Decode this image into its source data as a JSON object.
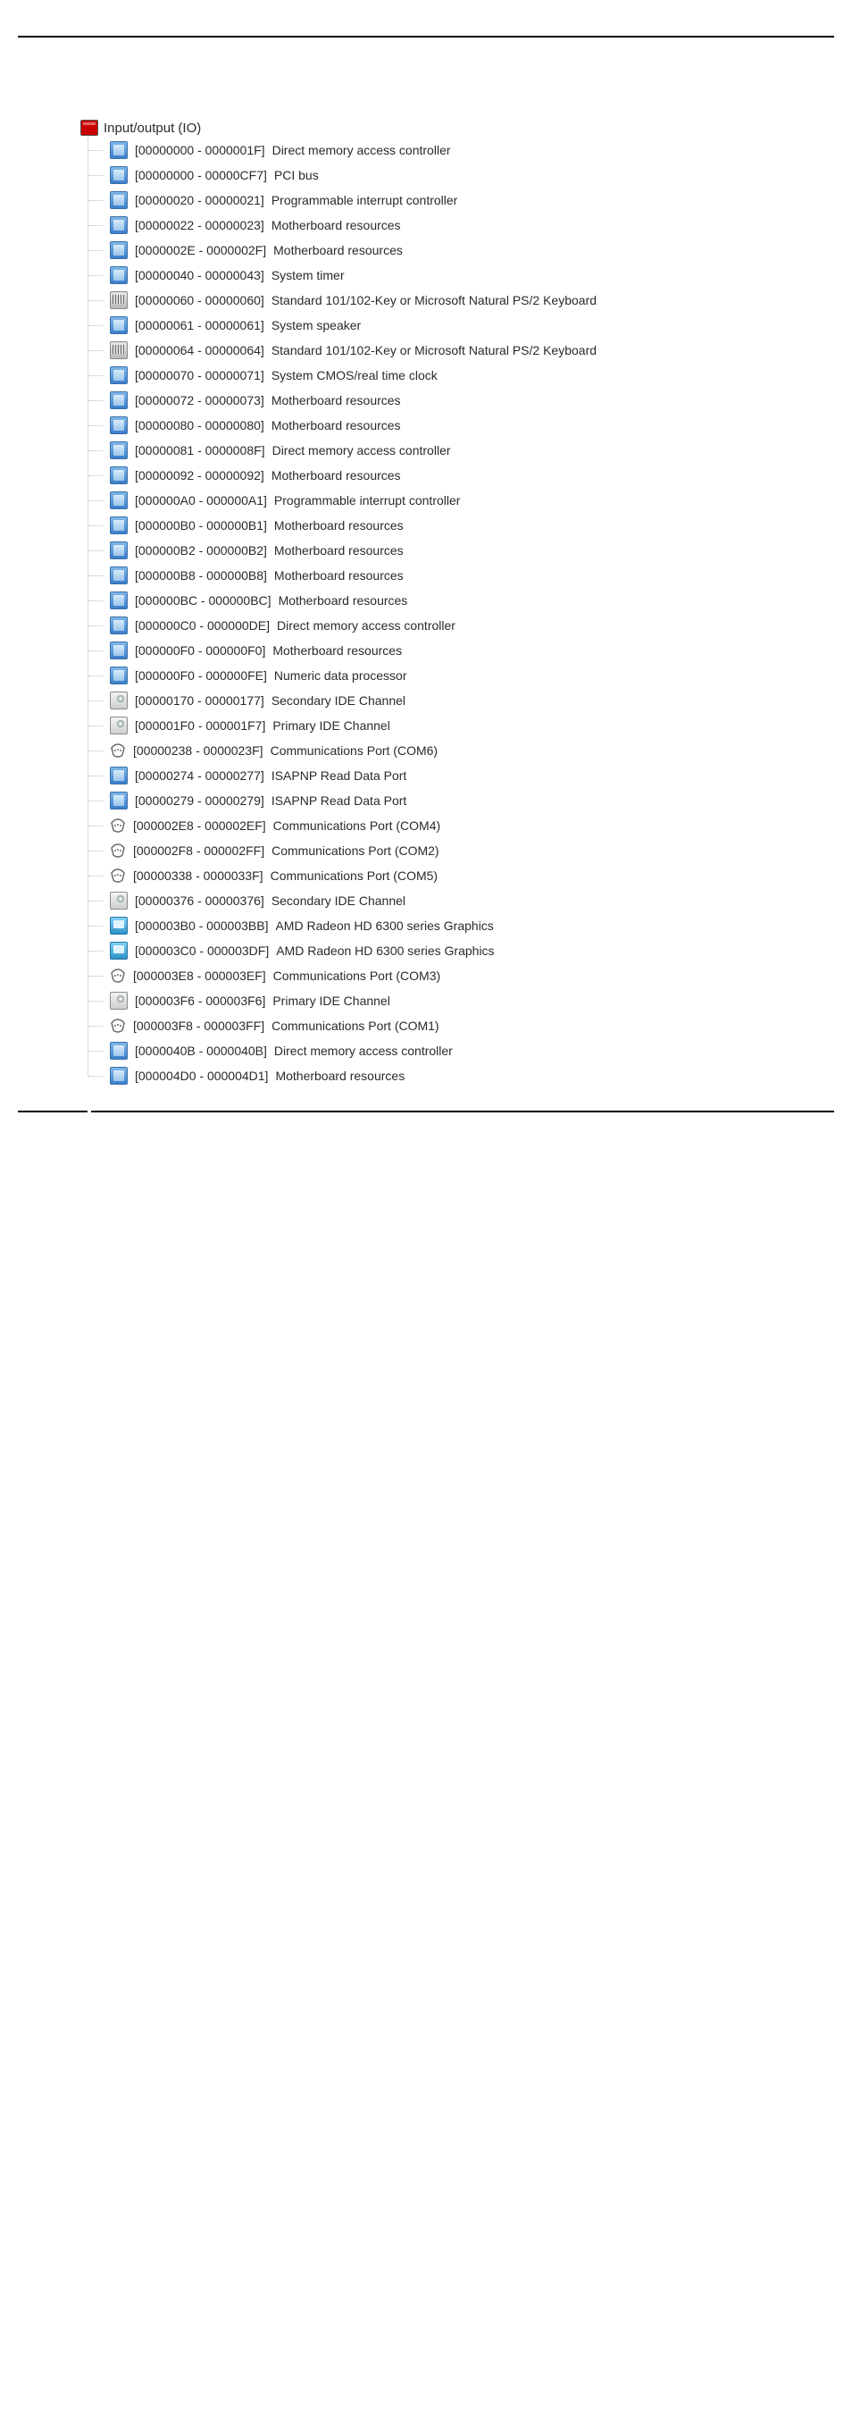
{
  "root": {
    "label": "Input/output (IO)"
  },
  "items": [
    {
      "icon": "chip",
      "range": "[00000000 - 0000001F]",
      "name": "Direct memory access controller"
    },
    {
      "icon": "chip",
      "range": "[00000000 - 00000CF7]",
      "name": "PCI bus"
    },
    {
      "icon": "chip",
      "range": "[00000020 - 00000021]",
      "name": "Programmable interrupt controller"
    },
    {
      "icon": "chip",
      "range": "[00000022 - 00000023]",
      "name": "Motherboard resources"
    },
    {
      "icon": "chip",
      "range": "[0000002E - 0000002F]",
      "name": "Motherboard resources"
    },
    {
      "icon": "chip",
      "range": "[00000040 - 00000043]",
      "name": "System timer"
    },
    {
      "icon": "kbd",
      "range": "[00000060 - 00000060]",
      "name": "Standard 101/102-Key or Microsoft Natural PS/2 Keyboard"
    },
    {
      "icon": "chip",
      "range": "[00000061 - 00000061]",
      "name": "System speaker"
    },
    {
      "icon": "kbd",
      "range": "[00000064 - 00000064]",
      "name": "Standard 101/102-Key or Microsoft Natural PS/2 Keyboard"
    },
    {
      "icon": "chip",
      "range": "[00000070 - 00000071]",
      "name": "System CMOS/real time clock"
    },
    {
      "icon": "chip",
      "range": "[00000072 - 00000073]",
      "name": "Motherboard resources"
    },
    {
      "icon": "chip",
      "range": "[00000080 - 00000080]",
      "name": "Motherboard resources"
    },
    {
      "icon": "chip",
      "range": "[00000081 - 0000008F]",
      "name": "Direct memory access controller"
    },
    {
      "icon": "chip",
      "range": "[00000092 - 00000092]",
      "name": "Motherboard resources"
    },
    {
      "icon": "chip",
      "range": "[000000A0 - 000000A1]",
      "name": "Programmable interrupt controller"
    },
    {
      "icon": "chip",
      "range": "[000000B0 - 000000B1]",
      "name": "Motherboard resources"
    },
    {
      "icon": "chip",
      "range": "[000000B2 - 000000B2]",
      "name": "Motherboard resources"
    },
    {
      "icon": "chip",
      "range": "[000000B8 - 000000B8]",
      "name": "Motherboard resources"
    },
    {
      "icon": "chip",
      "range": "[000000BC - 000000BC]",
      "name": "Motherboard resources"
    },
    {
      "icon": "chip",
      "range": "[000000C0 - 000000DE]",
      "name": "Direct memory access controller"
    },
    {
      "icon": "chip",
      "range": "[000000F0 - 000000F0]",
      "name": "Motherboard resources"
    },
    {
      "icon": "chip",
      "range": "[000000F0 - 000000FE]",
      "name": "Numeric data processor"
    },
    {
      "icon": "drive",
      "range": "[00000170 - 00000177]",
      "name": "Secondary IDE Channel"
    },
    {
      "icon": "drive",
      "range": "[000001F0 - 000001F7]",
      "name": "Primary IDE Channel"
    },
    {
      "icon": "port",
      "range": "[00000238 - 0000023F]",
      "name": "Communications Port (COM6)"
    },
    {
      "icon": "chip",
      "range": "[00000274 - 00000277]",
      "name": "ISAPNP Read Data Port"
    },
    {
      "icon": "chip",
      "range": "[00000279 - 00000279]",
      "name": "ISAPNP Read Data Port"
    },
    {
      "icon": "port",
      "range": "[000002E8 - 000002EF]",
      "name": "Communications Port (COM4)"
    },
    {
      "icon": "port",
      "range": "[000002F8 - 000002FF]",
      "name": "Communications Port (COM2)"
    },
    {
      "icon": "port",
      "range": "[00000338 - 0000033F]",
      "name": "Communications Port (COM5)"
    },
    {
      "icon": "drive",
      "range": "[00000376 - 00000376]",
      "name": "Secondary IDE Channel"
    },
    {
      "icon": "mon",
      "range": "[000003B0 - 000003BB]",
      "name": "AMD Radeon HD 6300 series Graphics"
    },
    {
      "icon": "mon",
      "range": "[000003C0 - 000003DF]",
      "name": "AMD Radeon HD 6300 series Graphics"
    },
    {
      "icon": "port",
      "range": "[000003E8 - 000003EF]",
      "name": "Communications Port (COM3)"
    },
    {
      "icon": "drive",
      "range": "[000003F6 - 000003F6]",
      "name": "Primary IDE Channel"
    },
    {
      "icon": "port",
      "range": "[000003F8 - 000003FF]",
      "name": "Communications Port (COM1)"
    },
    {
      "icon": "chip",
      "range": "[0000040B - 0000040B]",
      "name": "Direct memory access controller"
    },
    {
      "icon": "chip",
      "range": "[000004D0 - 000004D1]",
      "name": "Motherboard resources"
    }
  ]
}
